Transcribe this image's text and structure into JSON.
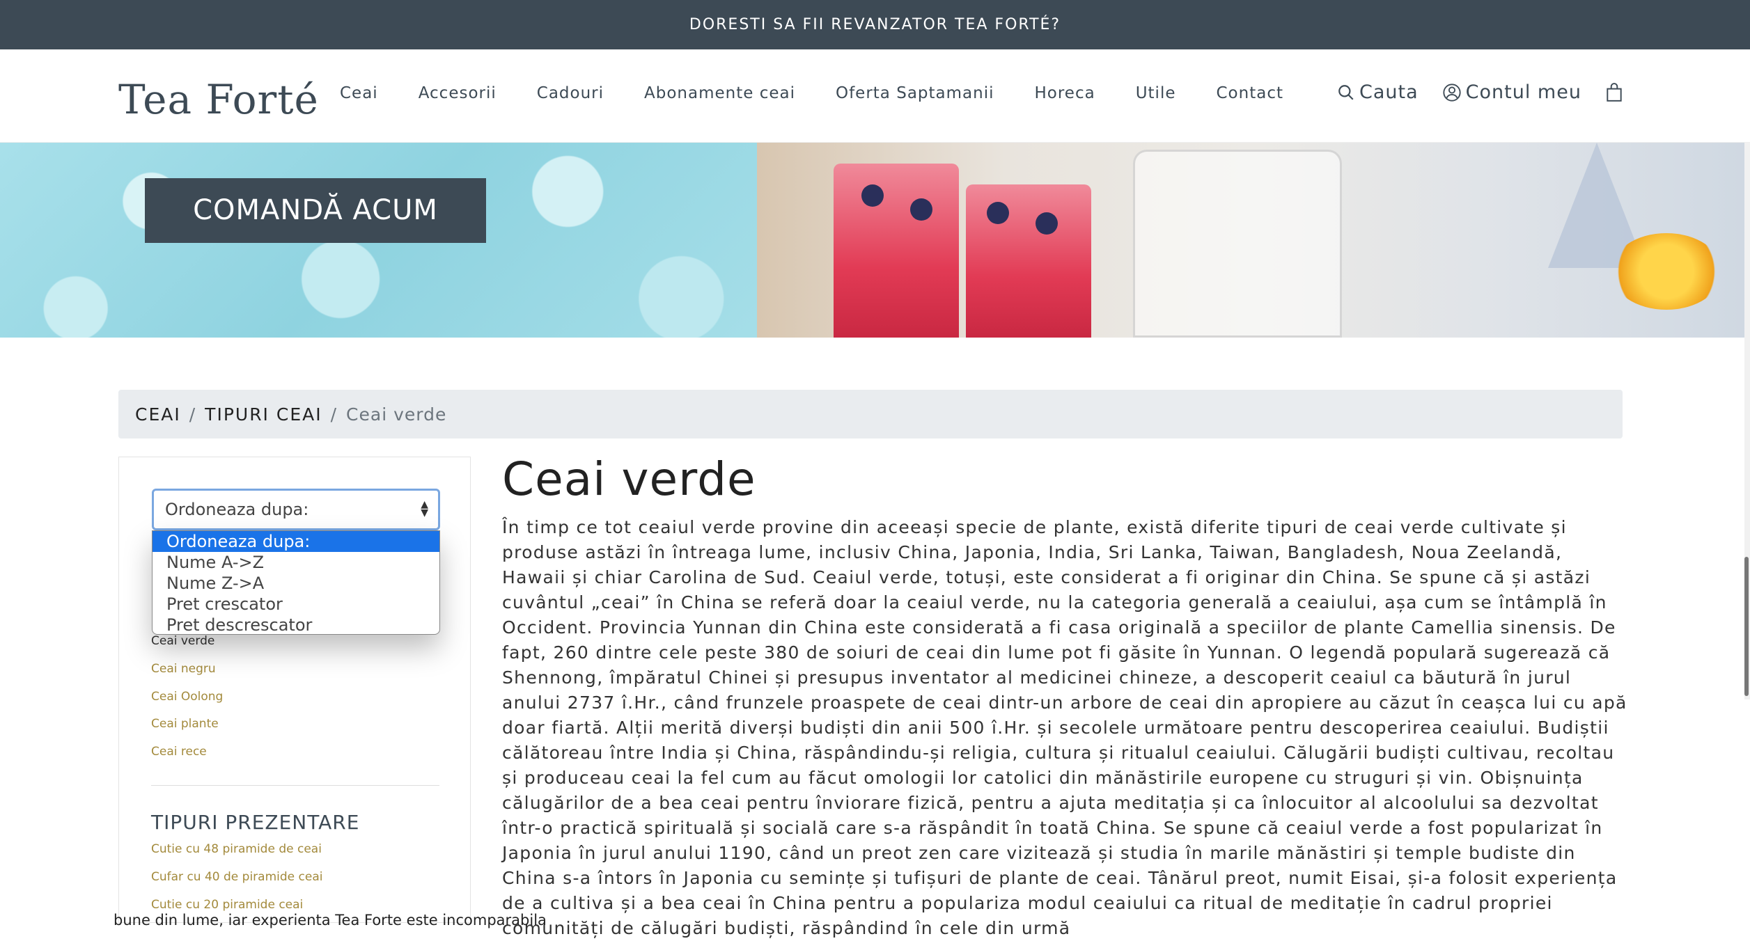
{
  "topbar": {
    "text": "DORESTI SA FII REVANZATOR TEA FORTÉ?"
  },
  "header": {
    "logo": "Tea Forté",
    "nav": [
      "Ceai",
      "Accesorii",
      "Cadouri",
      "Abonamente ceai",
      "Oferta Saptamanii",
      "Horeca",
      "Utile",
      "Contact"
    ],
    "search_label": "Cauta",
    "account_label": "Contul meu",
    "icons": {
      "search": "search-icon",
      "account": "user-icon",
      "cart": "shopping-bag-icon"
    }
  },
  "banner": {
    "cta_label": "COMANDĂ ACUM"
  },
  "breadcrumb": {
    "items": [
      "CEAI",
      "TIPURI CEAI"
    ],
    "current": "Ceai verde",
    "separator": "/"
  },
  "sidebar": {
    "sort": {
      "selected": "Ordoneaza dupa:",
      "options": [
        "Ordoneaza dupa:",
        "Nume A->Z",
        "Nume Z->A",
        "Pret crescator",
        "Pret descrescator"
      ]
    },
    "categories": [
      "Ceai verde",
      "Ceai negru",
      "Ceai Oolong",
      "Ceai plante",
      "Ceai rece"
    ],
    "presentation_title": "TIPURI PREZENTARE",
    "presentations": [
      "Cutie cu 48 piramide de ceai",
      "Cufar cu 40 de piramide ceai",
      "Cutie cu 20 piramide ceai"
    ]
  },
  "main": {
    "title": "Ceai verde",
    "description": "În timp ce tot ceaiul verde provine din aceeași specie de plante, există diferite tipuri de ceai verde cultivate și produse astăzi în întreaga lume, inclusiv China, Japonia, India, Sri Lanka, Taiwan, Bangladesh, Noua Zeelandă, Hawaii și chiar Carolina de Sud. Ceaiul verde, totuși, este considerat a fi originar din China. Se spune că și astăzi cuvântul „ceai” în China se referă doar la ceaiul verde, nu la categoria generală a ceaiului, așa cum se întâmplă în Occident. Provincia Yunnan din China este considerată a fi casa originală a speciilor de plante Camellia sinensis. De fapt, 260 dintre cele peste 380 de soiuri de ceai din lume pot fi găsite în Yunnan. O legendă populară sugerează că Shennong, împăratul Chinei și presupus inventator al medicinei chineze, a descoperit ceaiul ca băutură în jurul anului 2737 î.Hr., când frunzele proaspete de ceai dintr-un arbore de ceai din apropiere au căzut în ceașca lui cu apă doar fiartă. Alții merită diverși budiști din anii 500 î.Hr. și secolele următoare pentru descoperirea ceaiului. Budiștii călătoreau între India și China, răspândindu-și religia, cultura și ritualul ceaiului. Călugării budiști cultivau, recoltau și produceau ceai la fel cum au făcut omologii lor catolici din mănăstirile europene cu struguri și vin. Obișnuința călugărilor de a bea ceai pentru înviorare fizică, pentru a ajuta meditația și ca înlocuitor al alcoolului sa dezvoltat într-o practică spirituală și socială care s-a răspândit în toată China. Se spune că ceaiul verde a fost popularizat în Japonia în jurul anului 1190, când un preot zen care vizitează și studia în marile mănăstiri și temple budiste din China s-a întors în Japonia cu semințe și tufișuri de plante de ceai. Tânărul preot, numit Eisai, și-a folosit experiența de a cultiva și a bea ceai în China pentru a populariza modul ceaiului ca ritual de meditație în cadrul propriei comunități de călugări budiști, răspândind în cele din urmă",
    "bottom_overlay": "bune din lume, iar experienta Tea Forte este incomparabila"
  }
}
